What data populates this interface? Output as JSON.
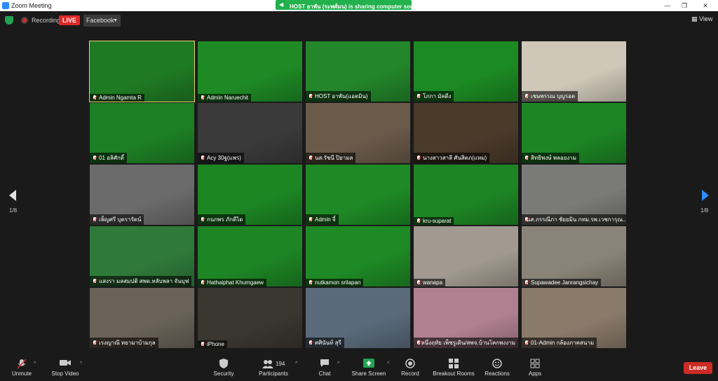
{
  "window": {
    "title": "Zoom Meeting",
    "minimize": "—",
    "maximize": "❐",
    "close": "✕"
  },
  "share_banner": {
    "text": "HOST อาพัน (ระพศ์มน) is sharing computer sound"
  },
  "topbar": {
    "recording_label": "Recording",
    "live_label": "LIVE",
    "stream_dropdown": "Facebook",
    "view_label": "View"
  },
  "pagination": {
    "left": "1/8",
    "right": "1/8"
  },
  "participants": [
    {
      "name": "Admin Ngamta R",
      "bg": "#1f7a24",
      "active": true
    },
    {
      "name": "Admin Naruechit",
      "bg": "#1e8a25"
    },
    {
      "name": "HOST อาพัน(แอดมิน)",
      "bg": "#23862a"
    },
    {
      "name": "โภกา มัลดีง",
      "bg": "#1c8a22"
    },
    {
      "name": "เชษพรรณ บุญรอด",
      "bg": "#cfc7b8"
    },
    {
      "name": "01 อลิศักดิ์",
      "bg": "#1d7f24"
    },
    {
      "name": "Acy 30ฐ(แพร)",
      "bg": "#3a3a3a"
    },
    {
      "name": "นส.รัชนี ปิยามล",
      "bg": "#6a5a4a"
    },
    {
      "name": "นางสาวสาลี ศันสิตภ(แหม)",
      "bg": "#4a3a2a"
    },
    {
      "name": "สิทธิพงษ์ พลอยงาม",
      "bg": "#1d8524"
    },
    {
      "name": "เพ็ญศรี บุตรารัตน์",
      "bg": "#6b6b6b"
    },
    {
      "name": "กนกพร ภักดีได",
      "bg": "#1c8623"
    },
    {
      "name": "Admin จี๋",
      "bg": "#1e8a25"
    },
    {
      "name": "kru-suparat",
      "bg": "#1d8524"
    },
    {
      "name": "นส.ภรรณีภา ชัยยมิน กทม.รพ.เวชการุณ...",
      "bg": "#7a7a78"
    },
    {
      "name": "แสงรา มลสมปติ สพด.หลับพลา จันบุฟ",
      "bg": "#2f7a3a"
    },
    {
      "name": "Hathaiphat Khumgaew",
      "bg": "#1d8524"
    },
    {
      "name": "nutkamon srilapan",
      "bg": "#1e8a25"
    },
    {
      "name": "wanapa",
      "bg": "#a29a90"
    },
    {
      "name": "Supawadee Janrangsichay",
      "bg": "#8a8478"
    },
    {
      "name": "เรงญาณี หยามาบ้ามกุล",
      "bg": "#6a6258"
    },
    {
      "name": "iPhone",
      "bg": "#3a3630"
    },
    {
      "name": "ศศินันท์ สุรี",
      "bg": "#5a6a7a"
    },
    {
      "name": "หนึ่งฤทัย เพ็ชรูเดิน/สพจ.บ้านโคกพงงาม",
      "bg": "#b08090"
    },
    {
      "name": "01-Admin กล้องภาคสนาม",
      "bg": "#8a7a6a"
    }
  ],
  "toolbar": {
    "unmute": "Unmute",
    "stop_video": "Stop Video",
    "security": "Security",
    "participants": "Participants",
    "participants_count": "194",
    "chat": "Chat",
    "share_screen": "Share Screen",
    "record": "Record",
    "breakout_rooms": "Breakout Rooms",
    "reactions": "Reactions",
    "apps": "Apps",
    "leave": "Leave"
  },
  "colors": {
    "accent": "#2d8cff",
    "live": "#e02828",
    "share": "#22b14c",
    "leave": "#cd2b24",
    "active_speaker": "#e8d46b"
  }
}
